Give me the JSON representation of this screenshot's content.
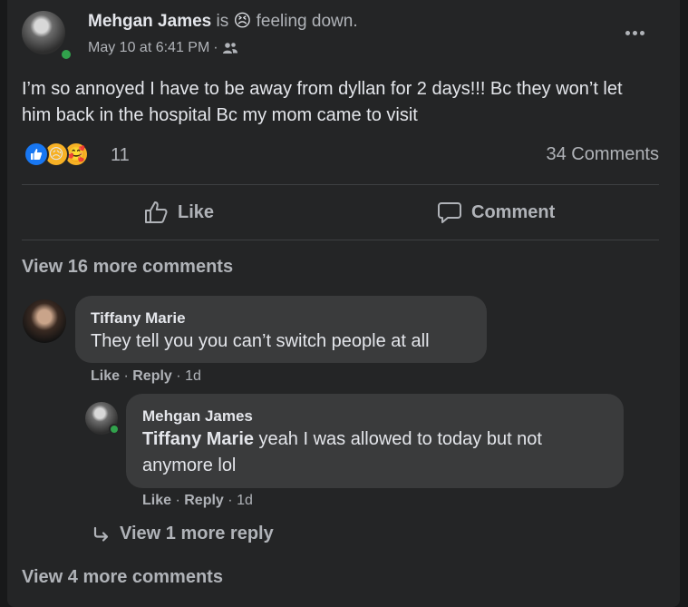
{
  "post": {
    "author": "Mehgan James",
    "feeling_prefix": "is",
    "feeling_emoji": "😣",
    "feeling_text": "feeling down.",
    "timestamp": "May 10 at 6:41 PM",
    "separator": "·",
    "audience_icon": "friends-icon",
    "more_icon": "•••",
    "body": "I’m so annoyed I have to be away from dyllan for 2 days!!! Bc they won’t let him back in the hospital Bc my mom came to visit",
    "reaction_count": "11",
    "reactions": [
      "like",
      "sad",
      "care"
    ],
    "comments_count": "34 Comments"
  },
  "actions": {
    "like_label": "Like",
    "comment_label": "Comment"
  },
  "comments": {
    "view_more_top": "View 16 more comments",
    "comment1": {
      "author": "Tiffany Marie",
      "text": "They tell you you can’t switch people at all",
      "like": "Like",
      "reply": "Reply",
      "time": "1d"
    },
    "reply1": {
      "author": "Mehgan James",
      "mention": "Tiffany Marie",
      "text": " yeah I was allowed to today but not anymore lol",
      "like": "Like",
      "reply": "Reply",
      "time": "1d"
    },
    "view_more_replies": "View 1 more reply",
    "view_more_bottom": "View 4 more comments"
  },
  "colors": {
    "background": "#18191a",
    "card": "#242526",
    "bubble": "#3a3b3c",
    "text_primary": "#e4e6eb",
    "text_secondary": "#b0b3b8",
    "online": "#31a24c",
    "like_blue": "#1877f2"
  }
}
